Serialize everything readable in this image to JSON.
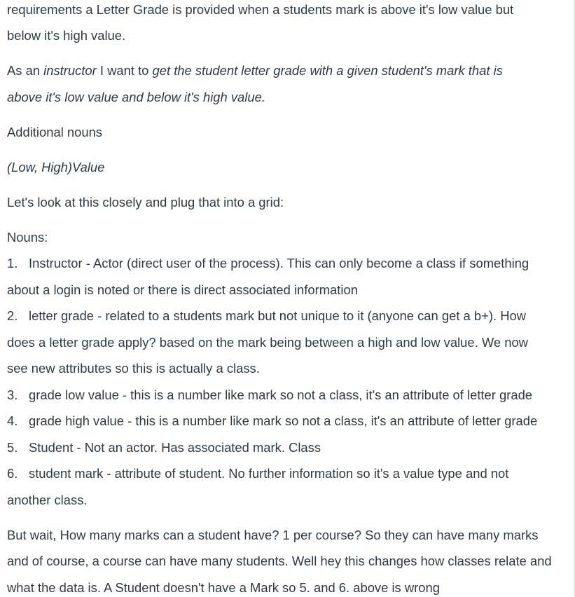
{
  "paragraphs": {
    "p1_line1": "requirements a Letter Grade is provided when a students mark is above it's low value but",
    "p1_line2": "below it's high value.",
    "p2_prefix": "As an ",
    "p2_actor": "instructor",
    "p2_middle": " I want to ",
    "p2_goal_line1": "get the student letter grade with a given student's mark that is",
    "p2_goal_line2": "above it's low value and below it's high value.",
    "p3": "Additional nouns",
    "p4": "(Low, High)Value",
    "p5": "Let's look at this closely and plug that into a grid:",
    "nouns_heading": "Nouns:"
  },
  "nouns_list": [
    {
      "num": "1.",
      "line1": "Instructor - Actor (direct user of the process). This can only become a class if something",
      "line2": "about a login is noted or there is direct associated information"
    },
    {
      "num": "2.",
      "line1": "letter grade - related to a students mark but not unique to it (anyone can get a b+). How",
      "line2": "does a letter grade apply? based on the mark being between a high and low value. We now",
      "line3": "see new attributes so this is actually a class."
    },
    {
      "num": "3.",
      "line1": "grade low value - this is a number like mark so not a class, it's an attribute of letter grade"
    },
    {
      "num": "4.",
      "line1": "grade high value - this is a number like mark so not a class, it's an attribute of letter grade"
    },
    {
      "num": "5.",
      "line1": "Student - Not an actor. Has associated mark. Class"
    },
    {
      "num": "6.",
      "line1": "student mark - attribute of student. No further information so it's a value type and not",
      "line2": "another class."
    }
  ],
  "closing": {
    "line1": "But wait, How many marks can a student have? 1 per course? So they can have many marks",
    "line2": "and of course, a course can have many students. Well hey this changes how classes relate and",
    "line3": "what the data is. A Student doesn't have a Mark so 5. and 6. above is wrong"
  }
}
